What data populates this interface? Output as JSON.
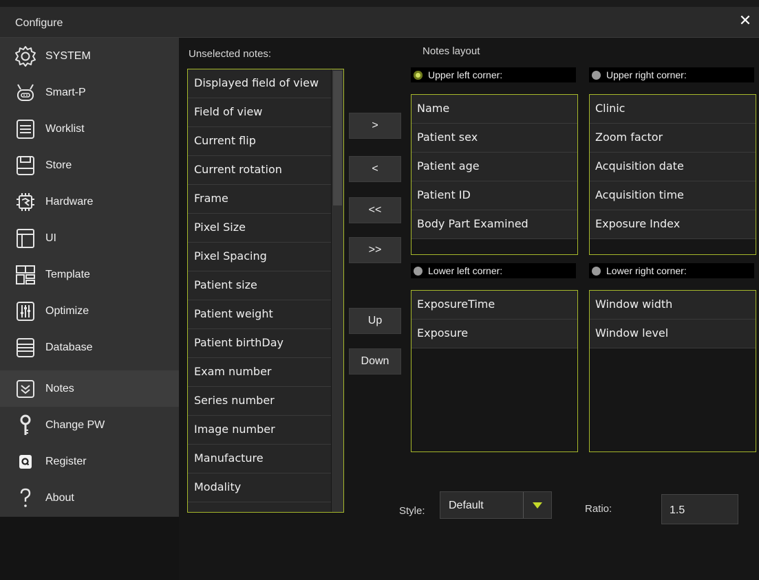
{
  "window": {
    "title": "Configure",
    "close_icon": "close-icon",
    "close_glyph": "✕"
  },
  "sidebar": {
    "items": [
      {
        "label": "SYSTEM",
        "icon": "gear-icon"
      },
      {
        "label": "Smart-P",
        "icon": "robot-icon"
      },
      {
        "label": "Worklist",
        "icon": "list-icon"
      },
      {
        "label": "Store",
        "icon": "floppy-icon"
      },
      {
        "label": "Hardware",
        "icon": "chip-icon"
      },
      {
        "label": "UI",
        "icon": "layout-icon"
      },
      {
        "label": "Template",
        "icon": "template-icon"
      },
      {
        "label": "Optimize",
        "icon": "sliders-icon"
      },
      {
        "label": "Database",
        "icon": "database-icon"
      },
      {
        "label": "Notes",
        "icon": "checkbox-icon"
      },
      {
        "label": "Change PW",
        "icon": "key-icon"
      },
      {
        "label": "Register",
        "icon": "register-icon"
      },
      {
        "label": "About",
        "icon": "question-icon"
      }
    ],
    "active": "Notes"
  },
  "notes": {
    "unselected_label": "Unselected notes:",
    "unselected": [
      "Displayed field of view",
      "Field of view",
      "Current flip",
      "Current rotation",
      "Frame",
      "Pixel Size",
      "Pixel Spacing",
      "Patient size",
      "Patient weight",
      "Patient birthDay",
      "Exam number",
      "Series number",
      "Image number",
      "Manufacture",
      "Modality"
    ],
    "buttons": {
      "move_right": ">",
      "move_left": "<",
      "move_all_left": "<<",
      "move_all_right": ">>",
      "up": "Up",
      "down": "Down"
    },
    "layout_label": "Notes layout",
    "corners": {
      "upper_left": {
        "label": "Upper left corner:",
        "selected": true,
        "items": [
          "Name",
          "Patient sex",
          "Patient age",
          "Patient ID",
          "Body Part Examined"
        ]
      },
      "upper_right": {
        "label": "Upper right corner:",
        "selected": false,
        "items": [
          "Clinic",
          "Zoom factor",
          "Acquisition date",
          "Acquisition time",
          "Exposure Index"
        ]
      },
      "lower_left": {
        "label": "Lower left corner:",
        "selected": false,
        "items": [
          "ExposureTime",
          "Exposure"
        ]
      },
      "lower_right": {
        "label": "Lower right corner:",
        "selected": false,
        "items": [
          "Window width",
          "Window level"
        ]
      }
    },
    "style_label": "Style:",
    "style_value": "Default",
    "ratio_label": "Ratio:",
    "ratio_value": "1.5"
  },
  "colors": {
    "accent": "#a7b92b",
    "radio_on": "#cfe060",
    "sidebar_bg": "#333333",
    "panel_bg": "#161616"
  }
}
